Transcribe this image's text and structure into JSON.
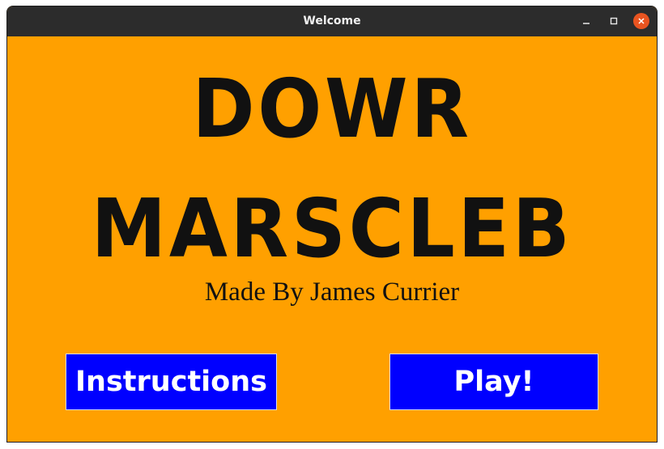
{
  "window": {
    "title": "Welcome",
    "controls": {
      "minimize_icon": "minimize-icon",
      "maximize_icon": "maximize-icon",
      "close_icon": "close-icon"
    }
  },
  "main": {
    "title_line1": "DOWR",
    "title_line2": "MARSCLEB",
    "byline": "Made By James Currier",
    "instructions_label": "Instructions",
    "play_label": "Play!"
  },
  "colors": {
    "background": "#ffa000",
    "button_bg": "#0000ff",
    "button_text": "#ffffff",
    "title_text": "#111111",
    "titlebar_bg": "#2c2c2c",
    "close_button": "#e95420"
  }
}
